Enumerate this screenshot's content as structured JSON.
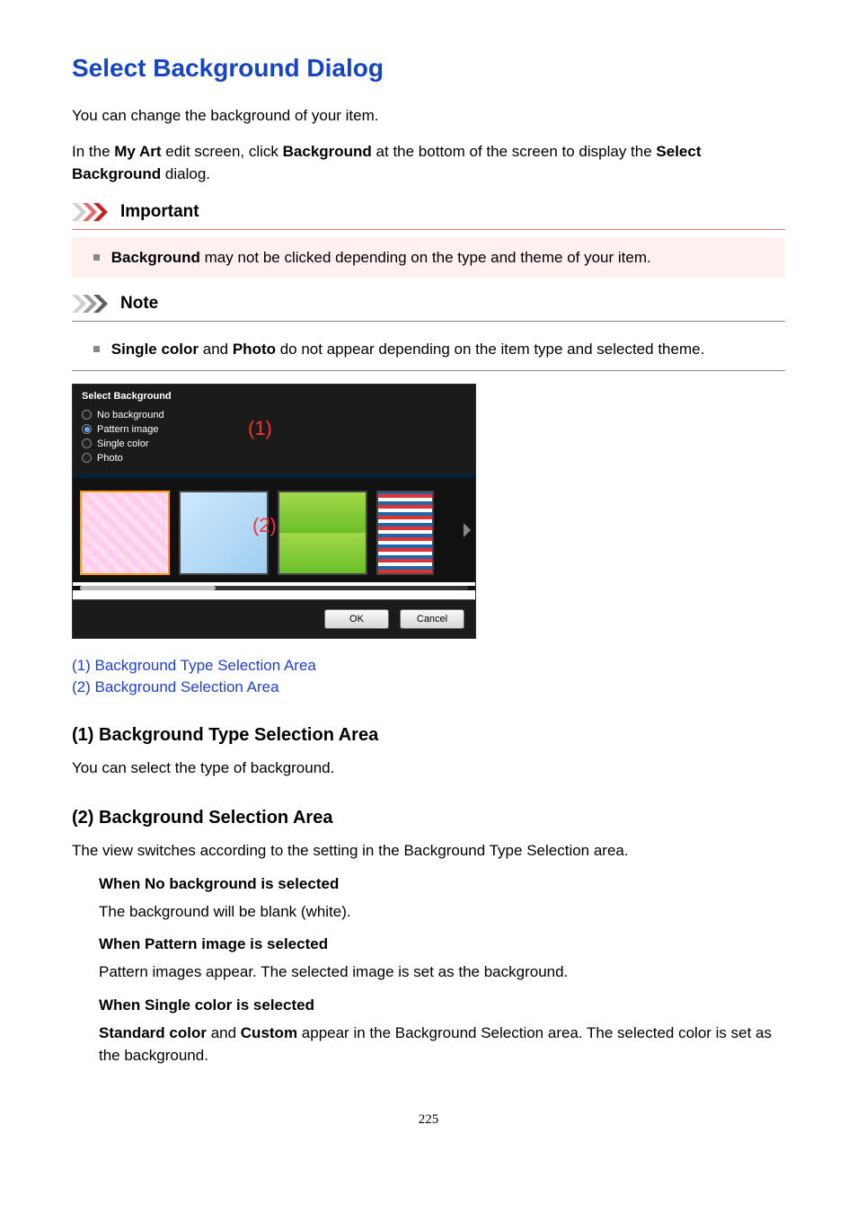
{
  "title": "Select Background Dialog",
  "intro": "You can change the background of your item.",
  "usage": {
    "pre": "In the ",
    "b1": "My Art",
    "mid1": " edit screen, click ",
    "b2": "Background",
    "mid2": " at the bottom of the screen to display the ",
    "b3": "Select Background",
    "post": " dialog."
  },
  "callouts": {
    "important_label": "Important",
    "note_label": "Note"
  },
  "important": {
    "b": "Background",
    "rest": " may not be clicked depending on the type and theme of your item."
  },
  "note": {
    "b1": "Single color",
    "mid": " and ",
    "b2": "Photo",
    "rest": " do not appear depending on the item type and selected theme."
  },
  "screenshot": {
    "title": "Select Background",
    "options": [
      "No background",
      "Pattern image",
      "Single color",
      "Photo"
    ],
    "selected_index": 1,
    "overlay1": "(1)",
    "overlay2": "(2)",
    "ok": "OK",
    "cancel": "Cancel"
  },
  "links": {
    "l1": "(1) Background Type Selection Area",
    "l2": "(2) Background Selection Area"
  },
  "sect1": {
    "heading": "(1) Background Type Selection Area",
    "body": "You can select the type of background."
  },
  "sect2": {
    "heading": "(2) Background Selection Area",
    "body": "The view switches according to the setting in the Background Type Selection area.",
    "defs": {
      "d1": {
        "t": "When No background is selected",
        "b": "The background will be blank (white)."
      },
      "d2": {
        "t": "When Pattern image is selected",
        "b": "Pattern images appear. The selected image is set as the background."
      },
      "d3": {
        "t": "When Single color is selected",
        "b1": "Standard color",
        "mid": " and ",
        "b2": "Custom",
        "rest": " appear in the Background Selection area. The selected color is set as the background."
      }
    }
  },
  "page_number": "225"
}
